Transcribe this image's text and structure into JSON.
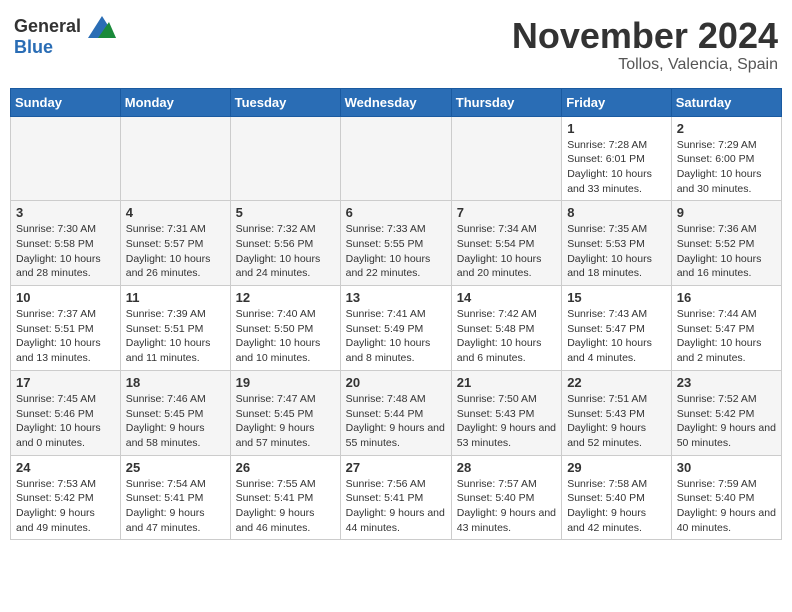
{
  "header": {
    "logo_general": "General",
    "logo_blue": "Blue",
    "month": "November 2024",
    "location": "Tollos, Valencia, Spain"
  },
  "weekdays": [
    "Sunday",
    "Monday",
    "Tuesday",
    "Wednesday",
    "Thursday",
    "Friday",
    "Saturday"
  ],
  "weeks": [
    [
      {
        "day": "",
        "info": ""
      },
      {
        "day": "",
        "info": ""
      },
      {
        "day": "",
        "info": ""
      },
      {
        "day": "",
        "info": ""
      },
      {
        "day": "",
        "info": ""
      },
      {
        "day": "1",
        "info": "Sunrise: 7:28 AM\nSunset: 6:01 PM\nDaylight: 10 hours and 33 minutes."
      },
      {
        "day": "2",
        "info": "Sunrise: 7:29 AM\nSunset: 6:00 PM\nDaylight: 10 hours and 30 minutes."
      }
    ],
    [
      {
        "day": "3",
        "info": "Sunrise: 7:30 AM\nSunset: 5:58 PM\nDaylight: 10 hours and 28 minutes."
      },
      {
        "day": "4",
        "info": "Sunrise: 7:31 AM\nSunset: 5:57 PM\nDaylight: 10 hours and 26 minutes."
      },
      {
        "day": "5",
        "info": "Sunrise: 7:32 AM\nSunset: 5:56 PM\nDaylight: 10 hours and 24 minutes."
      },
      {
        "day": "6",
        "info": "Sunrise: 7:33 AM\nSunset: 5:55 PM\nDaylight: 10 hours and 22 minutes."
      },
      {
        "day": "7",
        "info": "Sunrise: 7:34 AM\nSunset: 5:54 PM\nDaylight: 10 hours and 20 minutes."
      },
      {
        "day": "8",
        "info": "Sunrise: 7:35 AM\nSunset: 5:53 PM\nDaylight: 10 hours and 18 minutes."
      },
      {
        "day": "9",
        "info": "Sunrise: 7:36 AM\nSunset: 5:52 PM\nDaylight: 10 hours and 16 minutes."
      }
    ],
    [
      {
        "day": "10",
        "info": "Sunrise: 7:37 AM\nSunset: 5:51 PM\nDaylight: 10 hours and 13 minutes."
      },
      {
        "day": "11",
        "info": "Sunrise: 7:39 AM\nSunset: 5:51 PM\nDaylight: 10 hours and 11 minutes."
      },
      {
        "day": "12",
        "info": "Sunrise: 7:40 AM\nSunset: 5:50 PM\nDaylight: 10 hours and 10 minutes."
      },
      {
        "day": "13",
        "info": "Sunrise: 7:41 AM\nSunset: 5:49 PM\nDaylight: 10 hours and 8 minutes."
      },
      {
        "day": "14",
        "info": "Sunrise: 7:42 AM\nSunset: 5:48 PM\nDaylight: 10 hours and 6 minutes."
      },
      {
        "day": "15",
        "info": "Sunrise: 7:43 AM\nSunset: 5:47 PM\nDaylight: 10 hours and 4 minutes."
      },
      {
        "day": "16",
        "info": "Sunrise: 7:44 AM\nSunset: 5:47 PM\nDaylight: 10 hours and 2 minutes."
      }
    ],
    [
      {
        "day": "17",
        "info": "Sunrise: 7:45 AM\nSunset: 5:46 PM\nDaylight: 10 hours and 0 minutes."
      },
      {
        "day": "18",
        "info": "Sunrise: 7:46 AM\nSunset: 5:45 PM\nDaylight: 9 hours and 58 minutes."
      },
      {
        "day": "19",
        "info": "Sunrise: 7:47 AM\nSunset: 5:45 PM\nDaylight: 9 hours and 57 minutes."
      },
      {
        "day": "20",
        "info": "Sunrise: 7:48 AM\nSunset: 5:44 PM\nDaylight: 9 hours and 55 minutes."
      },
      {
        "day": "21",
        "info": "Sunrise: 7:50 AM\nSunset: 5:43 PM\nDaylight: 9 hours and 53 minutes."
      },
      {
        "day": "22",
        "info": "Sunrise: 7:51 AM\nSunset: 5:43 PM\nDaylight: 9 hours and 52 minutes."
      },
      {
        "day": "23",
        "info": "Sunrise: 7:52 AM\nSunset: 5:42 PM\nDaylight: 9 hours and 50 minutes."
      }
    ],
    [
      {
        "day": "24",
        "info": "Sunrise: 7:53 AM\nSunset: 5:42 PM\nDaylight: 9 hours and 49 minutes."
      },
      {
        "day": "25",
        "info": "Sunrise: 7:54 AM\nSunset: 5:41 PM\nDaylight: 9 hours and 47 minutes."
      },
      {
        "day": "26",
        "info": "Sunrise: 7:55 AM\nSunset: 5:41 PM\nDaylight: 9 hours and 46 minutes."
      },
      {
        "day": "27",
        "info": "Sunrise: 7:56 AM\nSunset: 5:41 PM\nDaylight: 9 hours and 44 minutes."
      },
      {
        "day": "28",
        "info": "Sunrise: 7:57 AM\nSunset: 5:40 PM\nDaylight: 9 hours and 43 minutes."
      },
      {
        "day": "29",
        "info": "Sunrise: 7:58 AM\nSunset: 5:40 PM\nDaylight: 9 hours and 42 minutes."
      },
      {
        "day": "30",
        "info": "Sunrise: 7:59 AM\nSunset: 5:40 PM\nDaylight: 9 hours and 40 minutes."
      }
    ]
  ]
}
